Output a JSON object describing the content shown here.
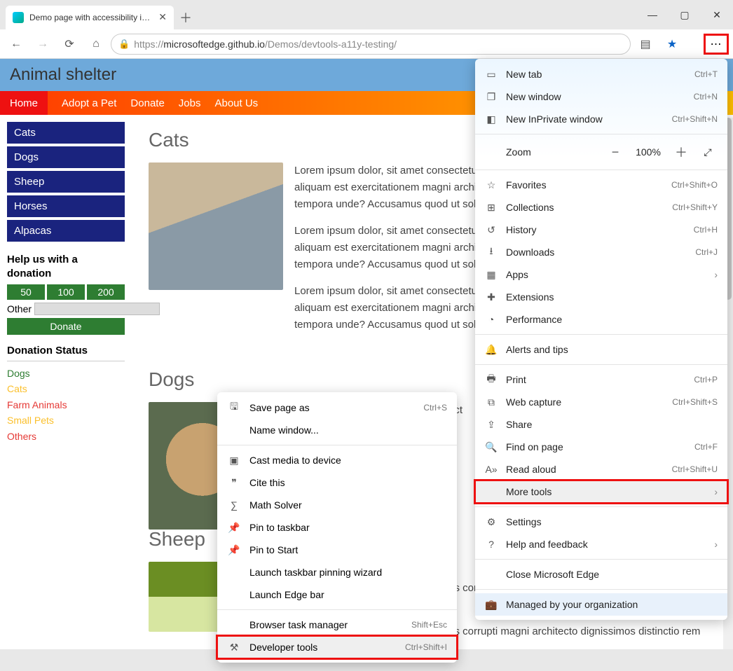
{
  "tab": {
    "title": "Demo page with accessibility iss…"
  },
  "url": {
    "host": "microsoftedge.github.io",
    "path": "/Demos/devtools-a11y-testing/",
    "prefix": "https://"
  },
  "page": {
    "banner": "Animal shelter",
    "nav": [
      "Home",
      "Adopt a Pet",
      "Donate",
      "Jobs",
      "About Us"
    ],
    "side": [
      "Cats",
      "Dogs",
      "Sheep",
      "Horses",
      "Alpacas"
    ],
    "help_heading": "Help us with a donation",
    "amounts": [
      "50",
      "100",
      "200"
    ],
    "other_label": "Other",
    "donate_label": "Donate",
    "status_heading": "Donation Status",
    "status": [
      {
        "t": "Dogs",
        "c": "ds-green"
      },
      {
        "t": "Cats",
        "c": "ds-yel"
      },
      {
        "t": "Farm Animals",
        "c": "ds-red"
      },
      {
        "t": "Small Pets",
        "c": "ds-yel"
      },
      {
        "t": "Others",
        "c": "ds-red"
      }
    ],
    "sections": {
      "cats": "Cats",
      "dogs": "Dogs",
      "sheep": "Sheep"
    },
    "lorem": "Lorem ipsum dolor, sit amet consectetur adipisicing elit. Obcaecati quos corrupti ratione a aliquam est exercitationem magni architecto dignissimos distinctio rem eligendi vitae tempora unde? Accusamus quod ut soluta voluptatum.",
    "lorem_short": "Lorem ipsum dolor, sit amet consect",
    "lorem_tail1": "etur adipisicing elit. Obcaecati quos corrupti magni architecto dignissimos distinctio rem mus quod ut soluta voluptatum.",
    "lorem_tail2": "etur adipisicing elit. Obcaecati quos corrupti magni architecto dignissimos distinctio rem"
  },
  "menu": {
    "items": [
      {
        "icon": "tab",
        "label": "New tab",
        "sc": "Ctrl+T"
      },
      {
        "icon": "win",
        "label": "New window",
        "sc": "Ctrl+N"
      },
      {
        "icon": "priv",
        "label": "New InPrivate window",
        "sc": "Ctrl+Shift+N"
      }
    ],
    "zoom": {
      "label": "Zoom",
      "pct": "100%"
    },
    "items2": [
      {
        "icon": "star",
        "label": "Favorites",
        "sc": "Ctrl+Shift+O"
      },
      {
        "icon": "coll",
        "label": "Collections",
        "sc": "Ctrl+Shift+Y"
      },
      {
        "icon": "hist",
        "label": "History",
        "sc": "Ctrl+H"
      },
      {
        "icon": "down",
        "label": "Downloads",
        "sc": "Ctrl+J"
      },
      {
        "icon": "apps",
        "label": "Apps",
        "sc": "",
        "chev": true
      },
      {
        "icon": "ext",
        "label": "Extensions",
        "sc": ""
      },
      {
        "icon": "perf",
        "label": "Performance",
        "sc": ""
      }
    ],
    "alerts": {
      "icon": "bell",
      "label": "Alerts and tips"
    },
    "items3": [
      {
        "icon": "print",
        "label": "Print",
        "sc": "Ctrl+P"
      },
      {
        "icon": "cap",
        "label": "Web capture",
        "sc": "Ctrl+Shift+S"
      },
      {
        "icon": "share",
        "label": "Share",
        "sc": ""
      },
      {
        "icon": "find",
        "label": "Find on page",
        "sc": "Ctrl+F"
      },
      {
        "icon": "read",
        "label": "Read aloud",
        "sc": "Ctrl+Shift+U"
      },
      {
        "icon": "tools",
        "label": "More tools",
        "sc": "",
        "chev": true,
        "hl": true,
        "red": true
      }
    ],
    "items4": [
      {
        "icon": "gear",
        "label": "Settings",
        "sc": ""
      },
      {
        "icon": "help",
        "label": "Help and feedback",
        "sc": "",
        "chev": true
      }
    ],
    "close": "Close Microsoft Edge",
    "managed": {
      "icon": "brief",
      "label": "Managed by your organization"
    }
  },
  "submenu": {
    "items": [
      {
        "icon": "save",
        "label": "Save page as",
        "sc": "Ctrl+S"
      },
      {
        "icon": "",
        "label": "Name window...",
        "sc": ""
      },
      {
        "icon": "cast",
        "label": "Cast media to device",
        "sc": ""
      },
      {
        "icon": "cite",
        "label": "Cite this",
        "sc": ""
      },
      {
        "icon": "math",
        "label": "Math Solver",
        "sc": ""
      },
      {
        "icon": "pin",
        "label": "Pin to taskbar",
        "sc": ""
      },
      {
        "icon": "pin",
        "label": "Pin to Start",
        "sc": ""
      },
      {
        "icon": "",
        "label": "Launch taskbar pinning wizard",
        "sc": ""
      },
      {
        "icon": "",
        "label": "Launch Edge bar",
        "sc": ""
      },
      {
        "icon": "",
        "label": "Browser task manager",
        "sc": "Shift+Esc"
      },
      {
        "icon": "dev",
        "label": "Developer tools",
        "sc": "Ctrl+Shift+I",
        "hl": true,
        "red": true
      }
    ]
  }
}
